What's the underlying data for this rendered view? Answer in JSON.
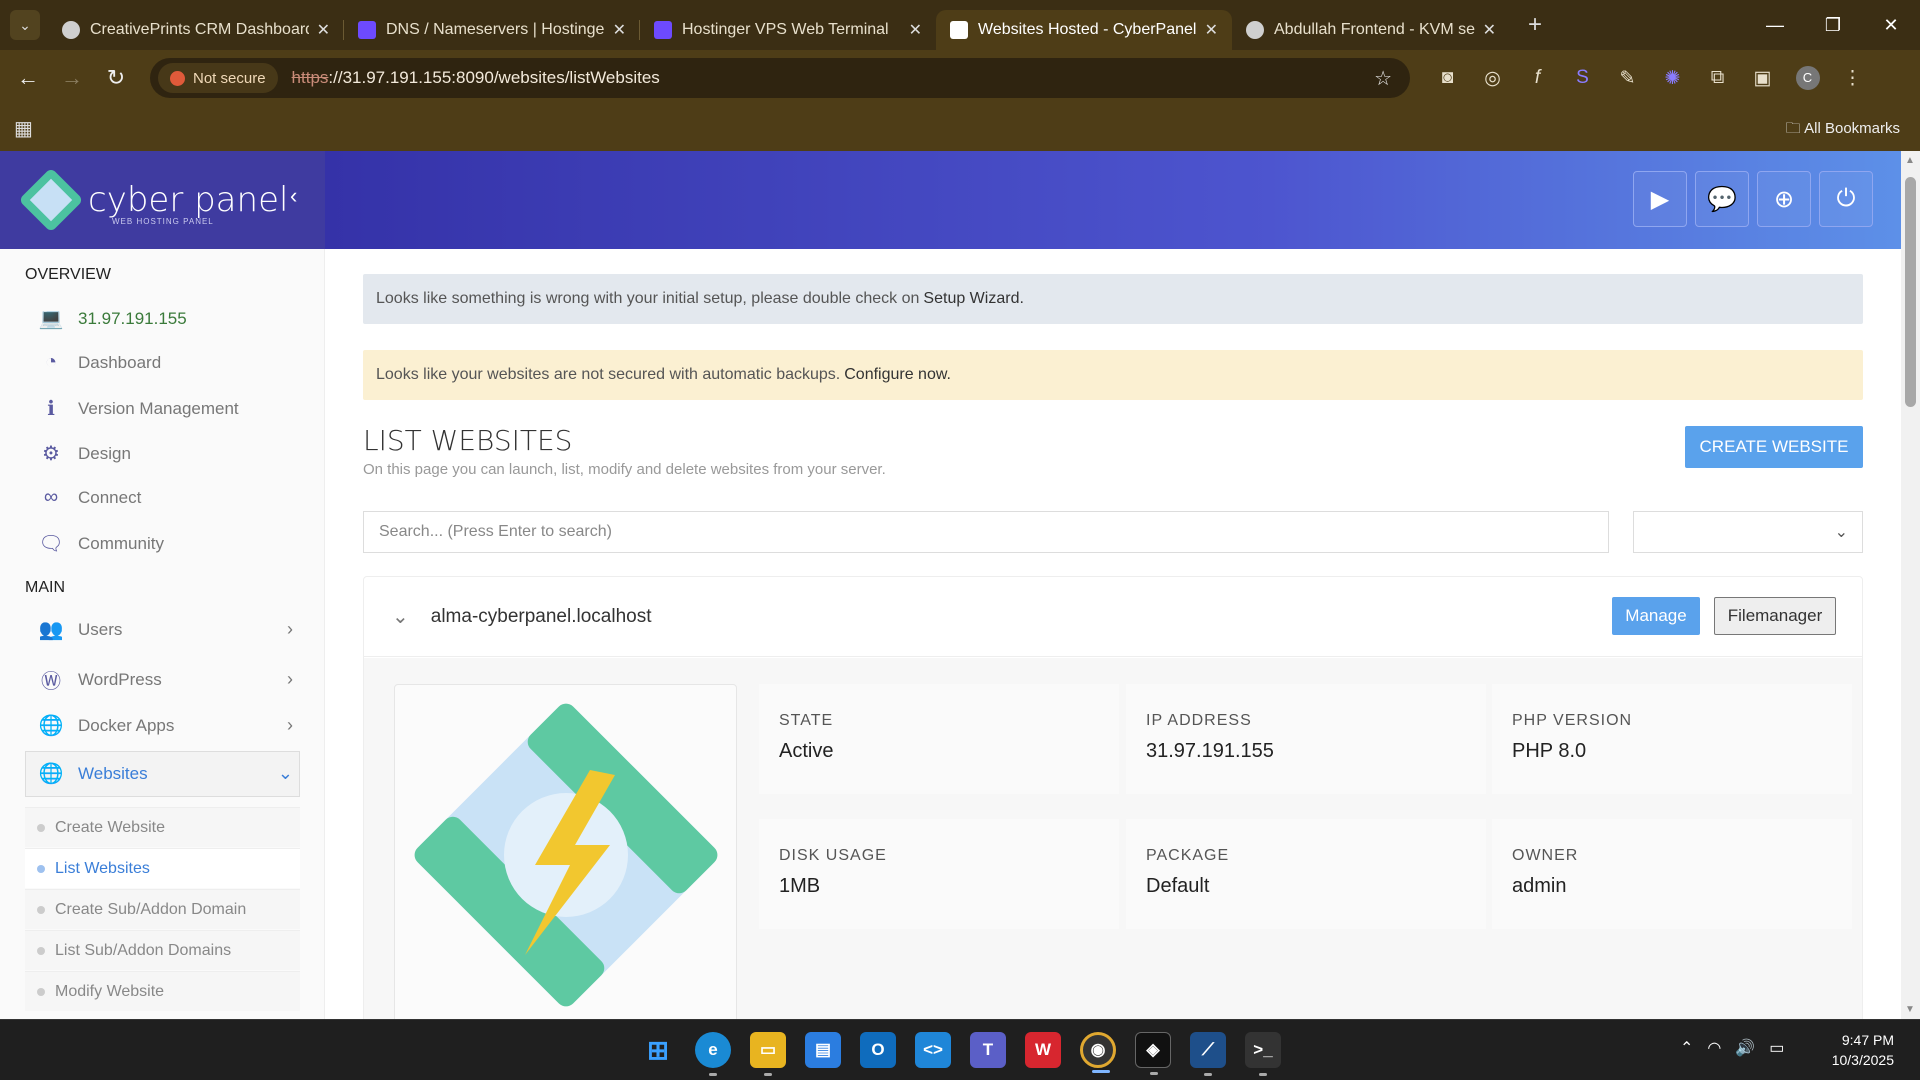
{
  "browser": {
    "tabs": [
      {
        "title": "CreativePrints CRM Dashboard",
        "favicon_color": "#cfcfcf",
        "active": false
      },
      {
        "title": "DNS / Nameservers | Hostinger",
        "favicon_color": "#6d4aff",
        "active": false
      },
      {
        "title": "Hostinger VPS Web Terminal",
        "favicon_color": "#6d4aff",
        "active": false
      },
      {
        "title": "Websites Hosted - CyberPanel",
        "favicon_color": "#ffffff",
        "active": true
      },
      {
        "title": "Abdullah Frontend - KVM setup",
        "favicon_color": "#cfcfcf",
        "active": false
      }
    ],
    "security_label": "Not secure",
    "url_scheme": "https",
    "url_rest": "://31.97.191.155:8090/websites/listWebsites",
    "bookmarks_label": "All Bookmarks",
    "profile_initial": "C"
  },
  "brand": {
    "name": "cyber panel",
    "tagline": "WEB HOSTING PANEL"
  },
  "sidebar": {
    "overview_title": "OVERVIEW",
    "ip": "31.97.191.155",
    "overview_items": [
      "Dashboard",
      "Version Management",
      "Design",
      "Connect",
      "Community"
    ],
    "main_title": "MAIN",
    "main_items": [
      "Users",
      "WordPress",
      "Docker Apps",
      "Websites"
    ],
    "sub_items": [
      "Create Website",
      "List Websites",
      "Create Sub/Addon Domain",
      "List Sub/Addon Domains",
      "Modify Website"
    ],
    "active_sub": "List Websites"
  },
  "alerts": {
    "setup_text": "Looks like something is wrong with your initial setup, please double check on",
    "setup_link": "Setup Wizard.",
    "backup_text": "Looks like your websites are not secured with automatic backups.",
    "backup_link": "Configure now."
  },
  "page": {
    "title": "LIST WEBSITES",
    "subtitle": "On this page you can launch, list, modify and delete websites from your server.",
    "create_label": "CREATE WEBSITE",
    "search_placeholder": "Search... (Press Enter to search)",
    "filter_value": ""
  },
  "website": {
    "domain": "alma-cyberpanel.localhost",
    "manage_label": "Manage",
    "filemanager_label": "Filemanager",
    "stats": [
      {
        "label": "STATE",
        "value": "Active"
      },
      {
        "label": "IP ADDRESS",
        "value": "31.97.191.155"
      },
      {
        "label": "PHP VERSION",
        "value": "PHP 8.0"
      },
      {
        "label": "DISK USAGE",
        "value": "1MB"
      },
      {
        "label": "PACKAGE",
        "value": "Default"
      },
      {
        "label": "OWNER",
        "value": "admin"
      }
    ]
  },
  "taskbar": {
    "time": "9:47 PM",
    "date": "10/3/2025"
  },
  "colors": {
    "accent": "#5aa2ec",
    "header_start": "#3532a8",
    "header_end": "#5d90e8",
    "sidebar_active": "#3a7ed8"
  }
}
